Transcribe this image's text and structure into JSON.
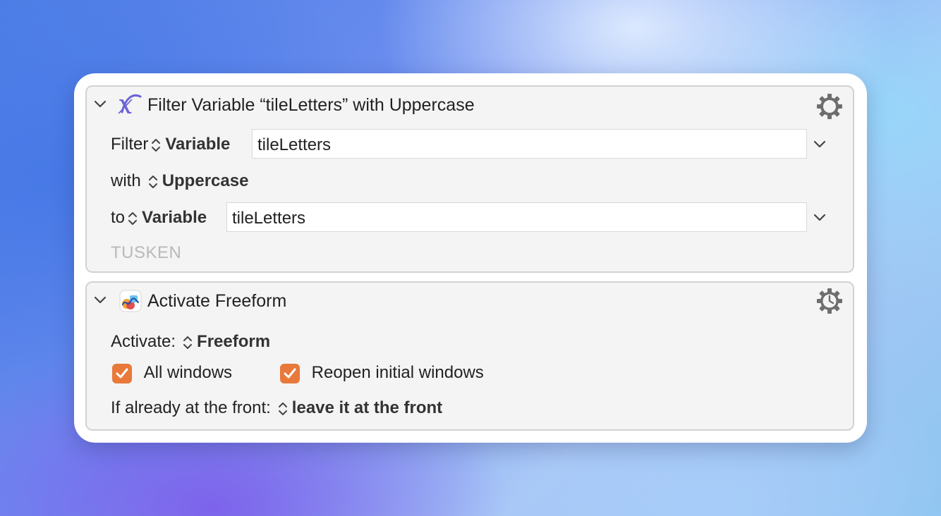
{
  "action1": {
    "title": "Filter Variable “tileLetters” with Uppercase",
    "filter_label": "Filter",
    "filter_type": "Variable",
    "filter_value": "tileLetters",
    "with_label": "with",
    "with_value": "Uppercase",
    "to_label": "to",
    "to_type": "Variable",
    "to_value": "tileLetters",
    "note": "TUSKEN"
  },
  "action2": {
    "title": "Activate Freeform",
    "activate_label": "Activate:",
    "activate_value": "Freeform",
    "all_windows_label": "All windows",
    "reopen_label": "Reopen initial windows",
    "front_label": "If already at the front:",
    "front_value": "leave it at the front"
  },
  "state": {
    "all_windows_checked": true,
    "reopen_checked": true
  },
  "colors": {
    "checkbox": "#e8793a",
    "variable_icon": "#6b63d8"
  },
  "icons": {
    "collapse": "chevron-down-icon",
    "variable": "variable-x-icon",
    "app": "freeform-app-icon",
    "gear": "gear-icon",
    "gear_clock": "gear-clock-icon",
    "dropdown": "chevron-down-icon"
  }
}
